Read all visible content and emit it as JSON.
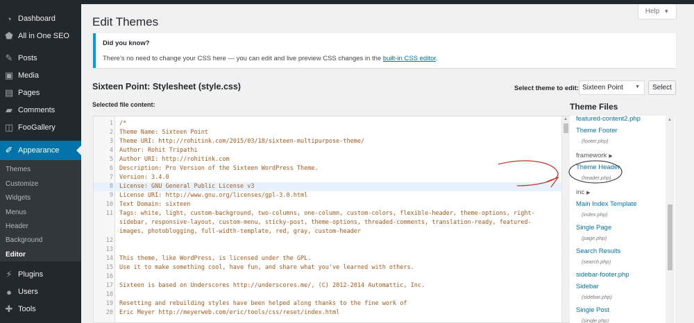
{
  "sidebar": {
    "items": [
      {
        "label": "Dashboard",
        "icon": "dashboard-icon"
      },
      {
        "label": "All in One SEO",
        "icon": "seo-icon"
      },
      {
        "label": "Posts",
        "icon": "pin-icon"
      },
      {
        "label": "Media",
        "icon": "media-icon"
      },
      {
        "label": "Pages",
        "icon": "page-icon"
      },
      {
        "label": "Comments",
        "icon": "comment-icon"
      },
      {
        "label": "FooGallery",
        "icon": "gallery-icon"
      },
      {
        "label": "Appearance",
        "icon": "brush-icon"
      },
      {
        "label": "Plugins",
        "icon": "plugin-icon"
      },
      {
        "label": "Users",
        "icon": "user-icon"
      },
      {
        "label": "Tools",
        "icon": "wrench-icon"
      }
    ],
    "submenu": [
      "Themes",
      "Customize",
      "Widgets",
      "Menus",
      "Header",
      "Background",
      "Editor"
    ]
  },
  "header": {
    "title": "Edit Themes",
    "help_label": "Help"
  },
  "notice": {
    "title": "Did you know?",
    "body_prefix": "There’s no need to change your CSS here — you can edit and live preview CSS changes in the ",
    "link": "built-in CSS editor",
    "body_suffix": "."
  },
  "editor_header": {
    "file_title": "Sixteen Point: Stylesheet (style.css)",
    "select_label": "Select theme to edit:",
    "selected_theme": "Sixteen Point",
    "select_button": "Select",
    "content_label": "Selected file content:"
  },
  "code_lines": [
    {
      "n": "1",
      "text": "/*"
    },
    {
      "n": "2",
      "text": "Theme Name: Sixteen Point"
    },
    {
      "n": "3",
      "text": "Theme URI: http://rohitink.com/2015/03/18/sixteen-multipurpose-theme/"
    },
    {
      "n": "4",
      "text": "Author: Rohit Tripathi"
    },
    {
      "n": "5",
      "text": "Author URI: http://rohitink.com"
    },
    {
      "n": "6",
      "text": "Description: Pro Version of the Sixteen WordPress Theme."
    },
    {
      "n": "7",
      "text": "Version: 3.4.0"
    },
    {
      "n": "8",
      "text": "License: GNU General Public License v3"
    },
    {
      "n": "9",
      "text": "License URI: http://www.gnu.org/licenses/gpl-3.0.html"
    },
    {
      "n": "10",
      "text": "Text Domain: sixteen"
    },
    {
      "n": "11",
      "text": "Tags: white, light, custom-background, two-columns, one-column, custom-colors, flexible-header, theme-options, right-"
    },
    {
      "n": "",
      "text": "sidebar, responsive-layout, custom-menu, sticky-post, theme-options, threaded-comments, translation-ready, featured-"
    },
    {
      "n": "",
      "text": "images, photoblogging, full-width-template, red, gray, custom-header"
    },
    {
      "n": "12",
      "text": ""
    },
    {
      "n": "13",
      "text": ""
    },
    {
      "n": "14",
      "text": "This theme, like WordPress, is licensed under the GPL."
    },
    {
      "n": "15",
      "text": "Use it to make something cool, have fun, and share what you've learned with others."
    },
    {
      "n": "16",
      "text": ""
    },
    {
      "n": "17",
      "text": "Sixteen is based on Underscores http://underscores.me/, (C) 2012-2014 Automattic, Inc."
    },
    {
      "n": "18",
      "text": ""
    },
    {
      "n": "19",
      "text": "Resetting and rebuilding styles have been helped along thanks to the fine work of"
    },
    {
      "n": "20",
      "text": "Eric Meyer http://meyerweb.com/eric/tools/css/reset/index.html"
    }
  ],
  "theme_files": {
    "heading": "Theme Files",
    "entries": [
      {
        "kind": "link",
        "label": "featured-content2.php"
      },
      {
        "kind": "link",
        "label": "Theme Footer"
      },
      {
        "kind": "sub",
        "label": "(footer.php)"
      },
      {
        "kind": "folder",
        "label": "framework"
      },
      {
        "kind": "link",
        "label": "Theme Header"
      },
      {
        "kind": "sub",
        "label": "(header.php)"
      },
      {
        "kind": "folder",
        "label": "inc"
      },
      {
        "kind": "link",
        "label": "Main Index Template"
      },
      {
        "kind": "sub",
        "label": "(index.php)"
      },
      {
        "kind": "link",
        "label": "Single Page"
      },
      {
        "kind": "sub",
        "label": "(page.php)"
      },
      {
        "kind": "link",
        "label": "Search Results"
      },
      {
        "kind": "sub",
        "label": "(search.php)"
      },
      {
        "kind": "link",
        "label": "sidebar-footer.php"
      },
      {
        "kind": "link",
        "label": "Sidebar"
      },
      {
        "kind": "sub",
        "label": "(sidebar.php)"
      },
      {
        "kind": "link",
        "label": "Single Post"
      },
      {
        "kind": "sub",
        "label": "(single.php)"
      }
    ]
  },
  "colors": {
    "admin_bar": "#23282d",
    "accent": "#0073aa",
    "notice_border": "#00a0d2",
    "code_text": "#a85a1a",
    "annotation": "#c0392b"
  }
}
